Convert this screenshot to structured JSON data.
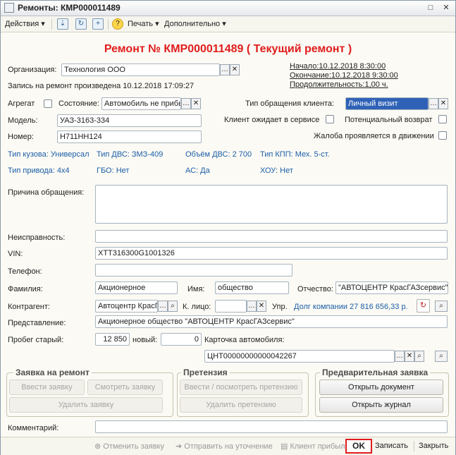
{
  "window": {
    "title": "Ремонты: КМР000011489"
  },
  "toolbar": {
    "actions": "Действия",
    "print": "Печать",
    "extra": "Дополнительно",
    "help_icon": "?"
  },
  "header": {
    "title": "Ремонт № КМР000011489 ( Текущий ремонт )"
  },
  "org": {
    "label": "Организация:",
    "value": "Технология ООО"
  },
  "dates": {
    "start": "Начало:10.12.2018 8:30:00",
    "end": "Окончание:10.12.2018 9:30:00",
    "duration": "Продолжительность:1,00 ч."
  },
  "record_info": "Запись на ремонт произведена 10.12.2018 17:09:27",
  "aggregate": {
    "label": "Агрегат",
    "state_label": "Состояние:",
    "state_value": "Автомобиль не прибы"
  },
  "appeal_type": {
    "label": "Тип обращения клиента:",
    "value": "Личный визит"
  },
  "model": {
    "label": "Модель:",
    "value": "УАЗ-3163-334"
  },
  "number": {
    "label": "Номер:",
    "value": "Н711НН124"
  },
  "checks": {
    "client_waits": "Клиент ожидает в сервисе",
    "potential_return": "Потенциальный возврат",
    "complaint_motion": "Жалоба проявляется в движении"
  },
  "specs": {
    "body": "Тип кузова: Универсал",
    "engine": "Тип ДВС: ЗМЗ-409",
    "volume": "Объём ДВС: 2 700",
    "gearbox": "Тип КПП: Мех. 5-ст.",
    "drive": "Тип привода: 4х4",
    "gbo": "ГБО: Нет",
    "ac": "АС: Да",
    "hou": "ХОУ: Нет"
  },
  "reason": {
    "label": "Причина обращения:",
    "value": ""
  },
  "fault": {
    "label": "Неисправность:",
    "value": ""
  },
  "vin": {
    "label": "VIN:",
    "value": "ХТТ316300G1001326"
  },
  "phone": {
    "label": "Телефон:",
    "value": ""
  },
  "surname": {
    "label": "Фамилия:",
    "value": "Акционерное"
  },
  "name": {
    "label": "Имя:",
    "value": "общество"
  },
  "patronymic": {
    "label": "Отчество:",
    "value": "\"АВТОЦЕНТР КрасГАЗсервис\""
  },
  "counterparty": {
    "label": "Контрагент:",
    "value": "Автоцентр КрасГ",
    "contact_label": "К. лицо:",
    "contact_value": "",
    "upr_label": "Упр.",
    "debt": "Долг компании 27 816 656,33 р."
  },
  "representation": {
    "label": "Представление:",
    "value": "Акционерное общество \"АВТОЦЕНТР КрасГАЗсервис\""
  },
  "mileage": {
    "old_label": "Пробег старый:",
    "old_value": "12 850",
    "new_label": "новый:",
    "new_value": "0",
    "card_label": "Карточка автомобиля:",
    "card_value": "ЦНТ00000000000042267"
  },
  "groups": {
    "order": {
      "title": "Заявка на ремонт",
      "enter": "Ввести заявку",
      "view": "Смотреть заявку",
      "delete": "Удалить заявку"
    },
    "claim": {
      "title": "Претензия",
      "enter": "Ввести / посмотреть претензию",
      "delete": "Удалить претензию"
    },
    "pre": {
      "title": "Предварительная заявка",
      "open_doc": "Открыть документ",
      "open_journal": "Открыть журнал"
    }
  },
  "comment": {
    "label": "Комментарий:",
    "value": ""
  },
  "bottom": {
    "cancel": "Отменить заявку",
    "send": "Отправить на уточнение",
    "arrived": "Клиент прибыл",
    "ok": "OK",
    "save": "Записать",
    "close": "Закрыть"
  }
}
